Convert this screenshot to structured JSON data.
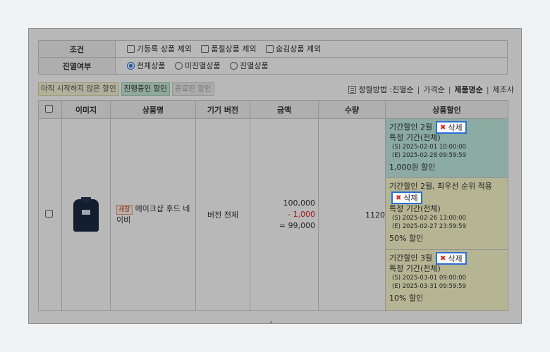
{
  "filters": {
    "condition": {
      "label": "조건",
      "options": [
        "기등록 상품 제외",
        "품절상품 제외",
        "숨김상품 제외"
      ]
    },
    "display": {
      "label": "진열여부",
      "options": [
        "전체상품",
        "미진열상품",
        "진열상품"
      ],
      "selected": "전체상품"
    }
  },
  "tags": [
    "아직 시작하지 않은 할인",
    "진행중인 할인",
    "종료된 할인"
  ],
  "sort": {
    "label": "정렬방법 : ",
    "options": [
      "진열순",
      "가격순",
      "제품명순",
      "제조사"
    ],
    "active": "제품명순"
  },
  "table": {
    "headers": [
      "이미지",
      "상품명",
      "기기 버전",
      "금액",
      "수량",
      "상품할인"
    ],
    "row": {
      "badge": "새창",
      "product_name": "메이크샵 후드 네이비",
      "device_version": "버전 전체",
      "price": {
        "original": "100,000",
        "discount": "- 1,000",
        "final": "= 99,000"
      },
      "quantity": "1120",
      "discounts": [
        {
          "title": "기간할인 2월",
          "type": "특정 기간(전체)",
          "start": "(S) 2025-02-01 10:00:00",
          "end": "(E) 2025-02-28 09:59:59",
          "amount": "1,000원 할인"
        },
        {
          "title": "기간할인 2월, 최우선 순위 적용",
          "type": "특정 기간(전체)",
          "start": "(S) 2025-02-26 13:00:00",
          "end": "(E) 2025-02-27 23:59:59",
          "amount": "50% 할인"
        },
        {
          "title": "기간할인 3월",
          "type": "특정 기간(전체)",
          "start": "(S) 2025-03-01 09:00:00",
          "end": "(E) 2025-03-31 09:59:59",
          "amount": "10% 할인"
        }
      ]
    }
  },
  "delete_label": "삭제",
  "delete_icon": "x-icon",
  "colors": {
    "teal": "#c2eee2",
    "yellow": "#fbfbce",
    "accent": "#2b6fd6",
    "minus": "#e01b1b"
  }
}
